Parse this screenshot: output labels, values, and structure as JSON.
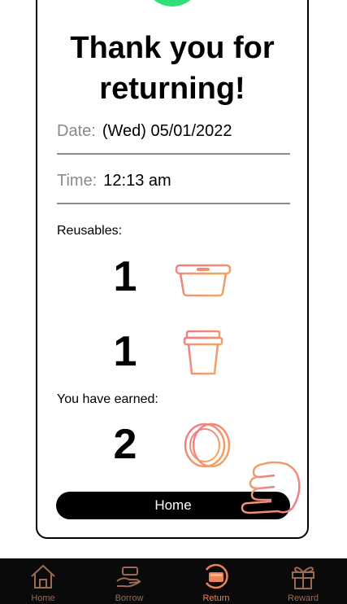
{
  "title": "Thank you for returning!",
  "date": {
    "label": "Date:",
    "value": "(Wed) 05/01/2022"
  },
  "time": {
    "label": "Time:",
    "value": "12:13 am"
  },
  "reusables": {
    "label": "Reusables:",
    "items": [
      {
        "count": "1",
        "icon": "food-container-icon"
      },
      {
        "count": "1",
        "icon": "cup-icon"
      }
    ]
  },
  "earned": {
    "label": "You have earned:",
    "count": "2",
    "icon": "coins-icon"
  },
  "home_button": "Home",
  "tabs": [
    {
      "label": "Home",
      "icon": "home-icon",
      "active": false
    },
    {
      "label": "Borrow",
      "icon": "borrow-hand-icon",
      "active": false
    },
    {
      "label": "Return",
      "icon": "return-box-icon",
      "active": true
    },
    {
      "label": "Reward",
      "icon": "gift-icon",
      "active": false
    }
  ],
  "colors": {
    "success": "#2fe07a",
    "accent": "#e8835a",
    "gradient_start": "#f07a8a",
    "gradient_end": "#f2a85a"
  }
}
